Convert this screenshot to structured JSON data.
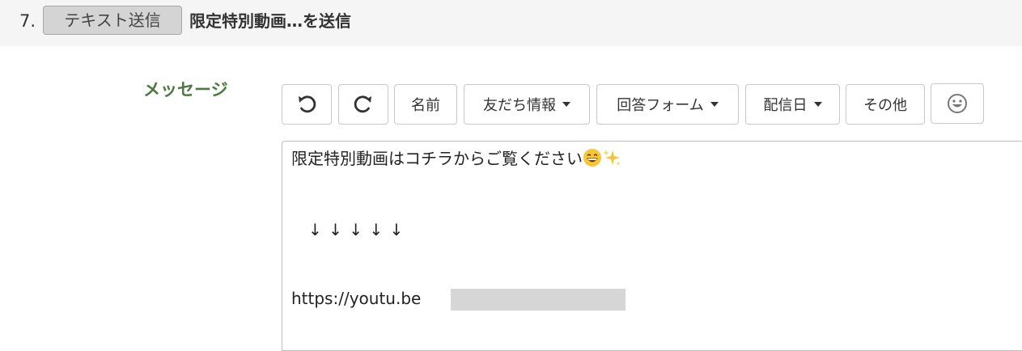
{
  "step": {
    "number": "7.",
    "type_label": "テキスト送信",
    "title": "限定特別動画…を送信"
  },
  "field": {
    "label": "メッセージ"
  },
  "toolbar": {
    "name_label": "名前",
    "friend_info_label": "友だち情報",
    "answer_form_label": "回答フォーム",
    "delivery_date_label": "配信日",
    "other_label": "その他"
  },
  "icons": {
    "undo": "undo-icon",
    "redo": "redo-icon",
    "emoji": "smiley-icon"
  },
  "message": {
    "line1": "限定特別動画はコチラからご覧ください",
    "line2": "↓ ↓ ↓ ↓ ↓",
    "line3": "https://youtu.be"
  },
  "colors": {
    "label_green": "#4b7a3e",
    "header_bg": "#f5f5f5",
    "chip_bg": "#d4d4d4"
  }
}
